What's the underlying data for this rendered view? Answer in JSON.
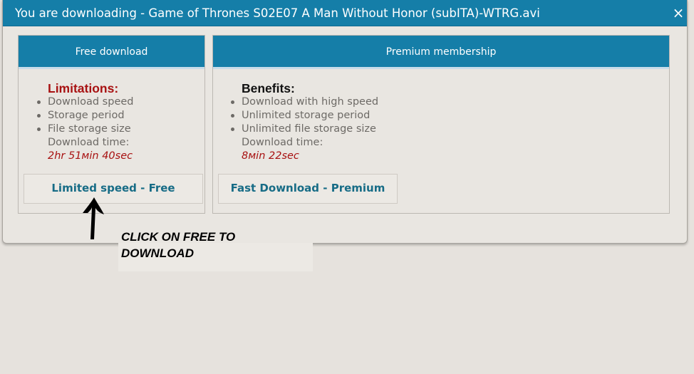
{
  "dialog": {
    "title": "You are downloading - Game of Thrones S02E07 A Man Without Honor (subITA)-WTRG.avi",
    "close_label": "×"
  },
  "free": {
    "header": "Free download",
    "heading": "Limitations:",
    "items": [
      "Download speed",
      "Storage period",
      "File storage size"
    ],
    "time_label": "Download time:",
    "time_value": "2hr 51мin 40sec",
    "button_label": "Limited speed - Free"
  },
  "premium": {
    "header": "Premium membership",
    "heading": "Benefits:",
    "items": [
      "Download with high speed",
      "Unlimited storage period",
      "Unlimited file storage size"
    ],
    "time_label": "Download time:",
    "time_value": "8мin 22sec",
    "button_label": "Fast Download - Premium"
  },
  "annotation": {
    "text": "CLICK ON FREE TO DOWNLOAD"
  },
  "colors": {
    "accent": "#157ea8",
    "limit_red": "#a81212",
    "button_text": "#176c86",
    "body_text": "#6d6a66"
  },
  "icons": {
    "close": "close-icon",
    "bullet": "bullet-icon",
    "arrow": "arrow-up-icon"
  }
}
